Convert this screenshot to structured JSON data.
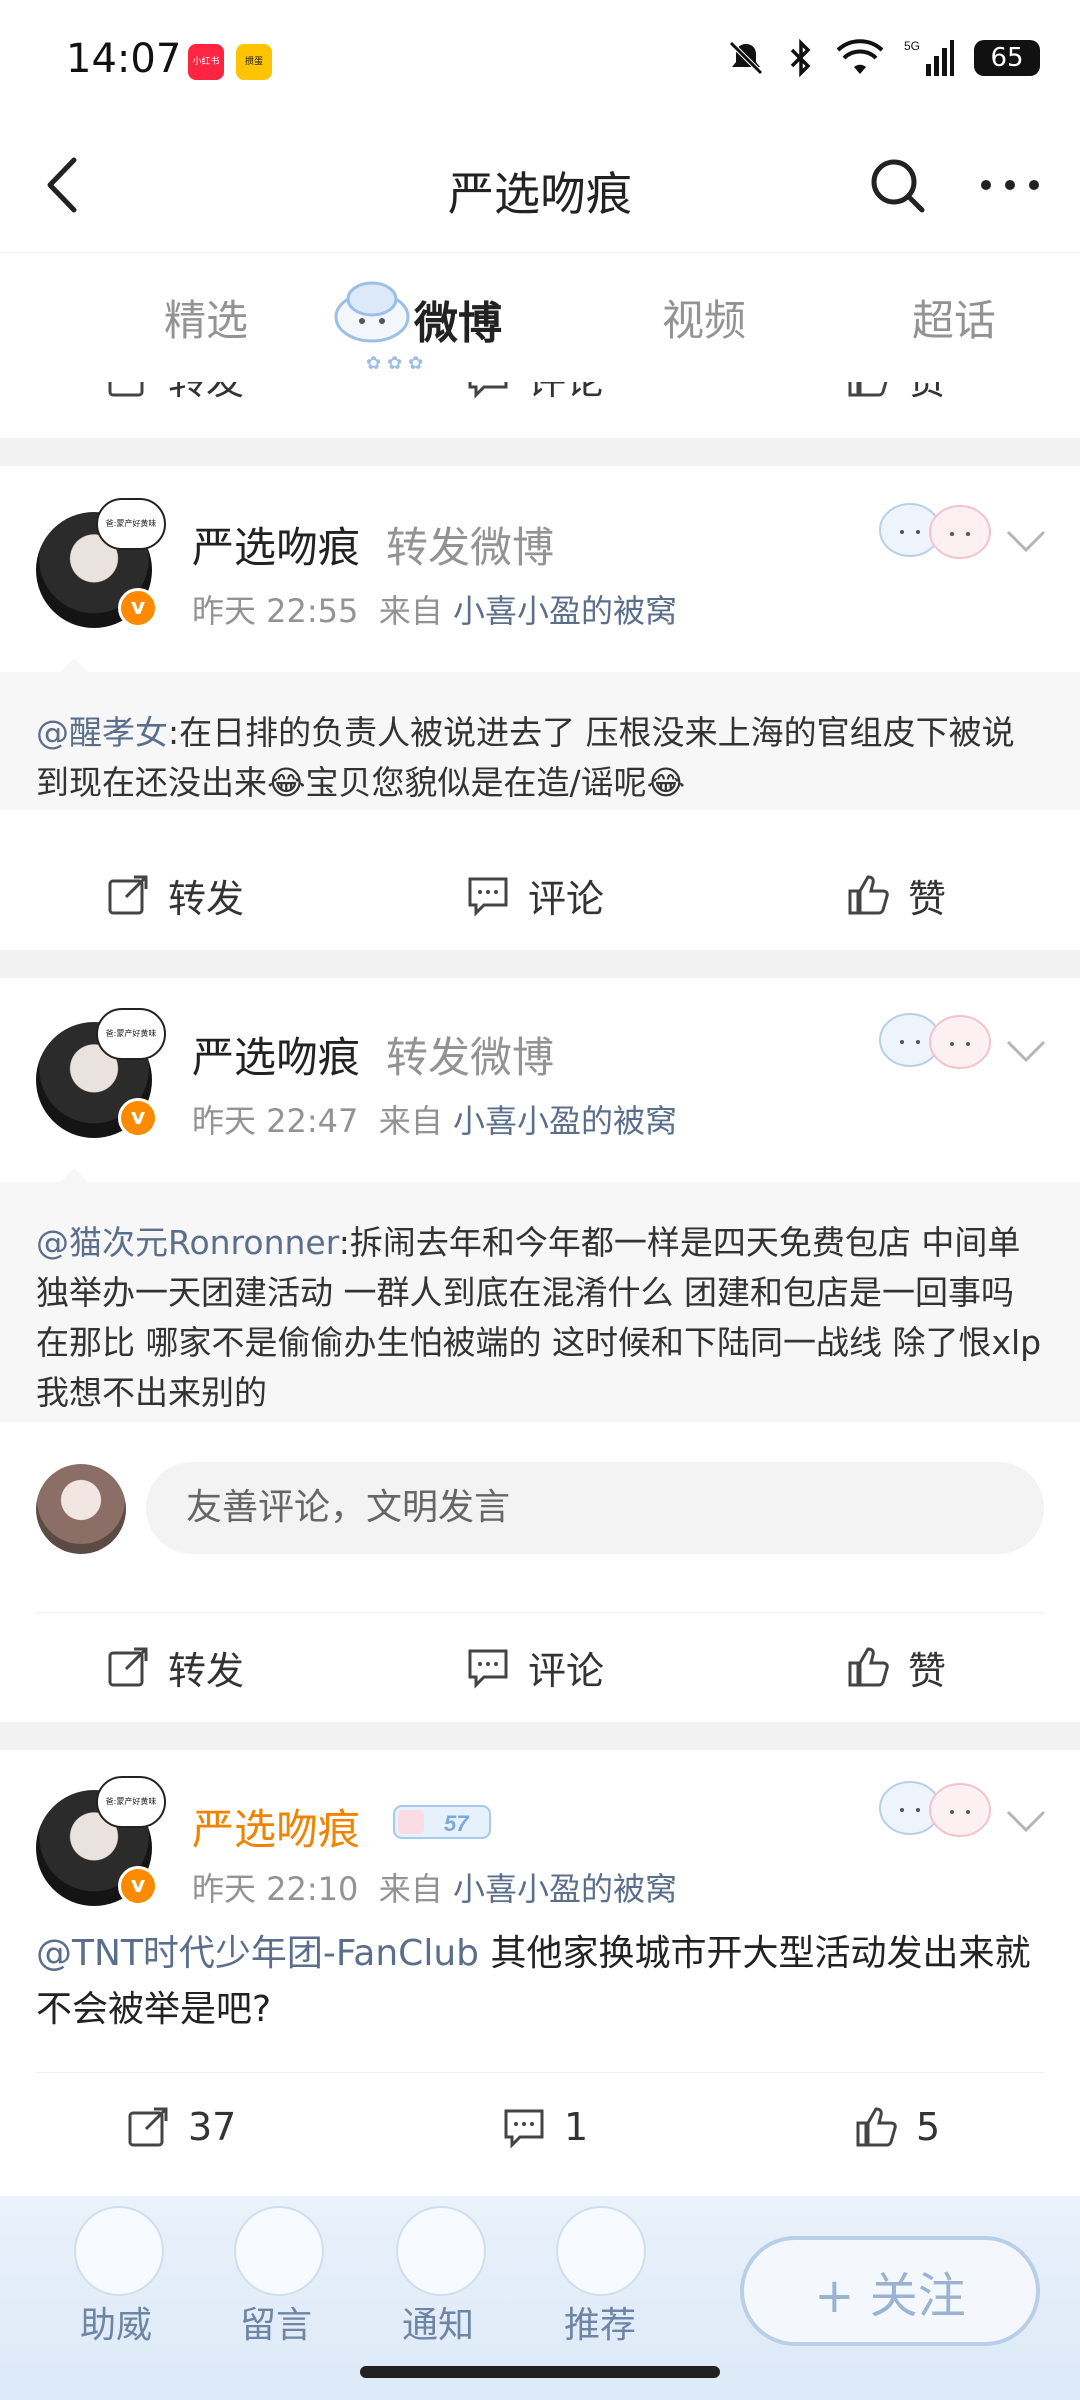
{
  "status": {
    "time": "14:07",
    "app_icon_1": "小红书",
    "app_icon_2": "掼蛋",
    "battery": "65",
    "network": "5G",
    "icons": [
      "mute-bell-icon",
      "bluetooth-icon",
      "wifi-icon",
      "signal-icon",
      "battery-icon"
    ]
  },
  "nav": {
    "title": "严选吻痕",
    "icons": [
      "back-arrow-icon",
      "search-icon",
      "more-icon"
    ]
  },
  "tabs": {
    "items": [
      "精选",
      "微博",
      "视频",
      "超话"
    ],
    "active": "微博"
  },
  "partial_actions": {
    "repost": "转发",
    "comment": "评论",
    "like": "赞"
  },
  "posts": [
    {
      "user": "严选吻痕",
      "tag": "转发微博",
      "time": "昨天 22:55",
      "from_label": "来自",
      "source": "小喜小盈的被窝",
      "avatar_bubble": "爸:蒙产好黄味",
      "quote_at": "@醒孝女",
      "quote_text": ":在日排的负责人被说进去了 压根没来上海的官组皮下被说到现在还没出来😂宝贝您貌似是在造/谣呢😂",
      "actions": {
        "repost": "转发",
        "comment": "评论",
        "like": "赞"
      }
    },
    {
      "user": "严选吻痕",
      "tag": "转发微博",
      "time": "昨天 22:47",
      "from_label": "来自",
      "source": "小喜小盈的被窝",
      "avatar_bubble": "爸:蒙产好黄味",
      "quote_at": "@猫次元Ronronner",
      "quote_text": ":拆闹去年和今年都一样是四天免费包店 中间单独举办一天团建活动 一群人到底在混淆什么 团建和包店是一回事吗在那比 哪家不是偷偷办生怕被端的 这时候和下陆同一战线 除了恨xlp我想不出来别的",
      "comment_placeholder": "友善评论，文明发言",
      "actions": {
        "repost": "转发",
        "comment": "评论",
        "like": "赞"
      }
    },
    {
      "user": "严选吻痕",
      "level": "57",
      "time": "昨天 22:10",
      "from_label": "来自",
      "source": "小喜小盈的被窝",
      "avatar_bubble": "爸:蒙产好黄味",
      "body_at": "@TNT时代少年团-FanClub",
      "body_text": " 其他家换城市开大型活动发出来就不会被举是吧?",
      "actions": {
        "repost": "37",
        "comment": "1",
        "like": "5"
      }
    }
  ],
  "bottom_bar": {
    "items": [
      "助威",
      "留言",
      "通知",
      "推荐"
    ],
    "follow": "+ 关注"
  },
  "colors": {
    "link": "#5b6f8d",
    "orange": "#f08300",
    "grey_text": "#939393",
    "separator": "#f2f2f2"
  }
}
